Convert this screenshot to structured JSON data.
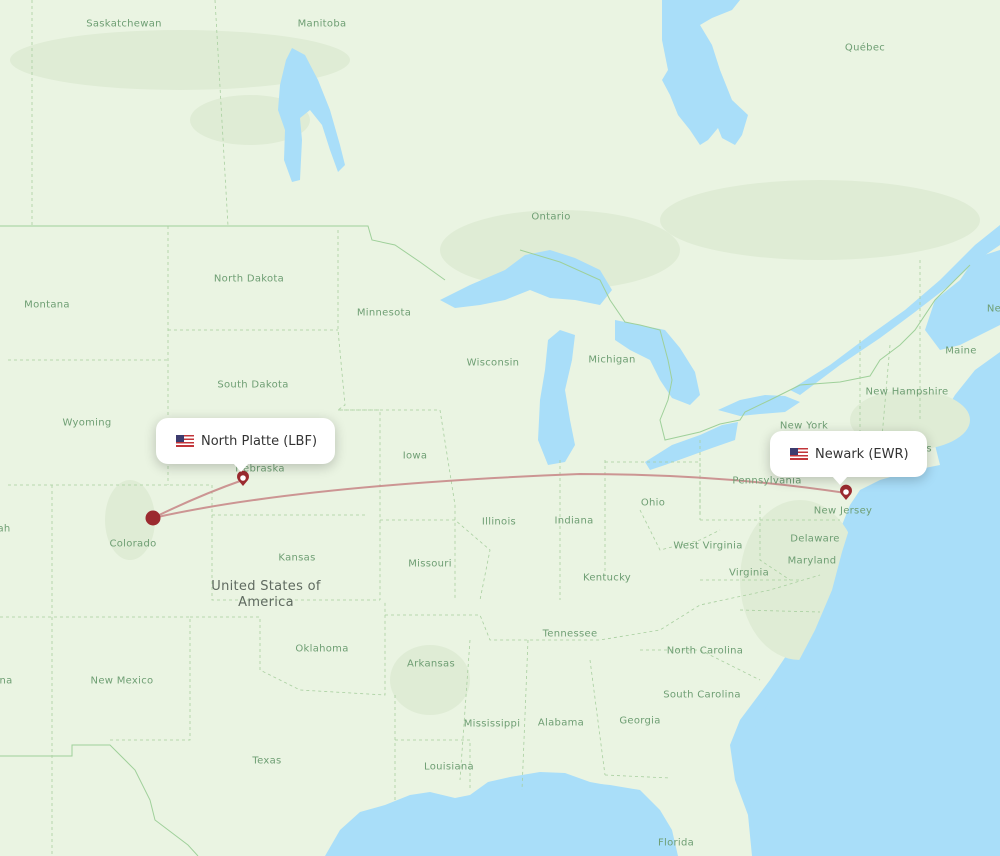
{
  "map": {
    "colors": {
      "water": "#a9def9",
      "land": "#eaf4e2",
      "land_dark": "#dfecd5",
      "border_country": "#9fd09a",
      "border_state": "#a8cf9f",
      "route": "#c98b8b",
      "marker": "#9b2a2f"
    },
    "popups": [
      {
        "id": "lbf",
        "flag": "us-flag-icon",
        "label": "North Platte (LBF)"
      },
      {
        "id": "ewr",
        "flag": "us-flag-icon",
        "label": "Newark (EWR)"
      }
    ],
    "region_labels": {
      "saskatchewan": "Saskatchewan",
      "manitoba": "Manitoba",
      "quebec": "Québec",
      "ontario": "Ontario",
      "montana": "Montana",
      "north_dakota": "North Dakota",
      "minnesota": "Minnesota",
      "south_dakota": "South Dakota",
      "wyoming": "Wyoming",
      "nebraska": "Nebraska",
      "iowa": "Iowa",
      "wisconsin": "Wisconsin",
      "michigan": "Michigan",
      "colorado": "Colorado",
      "kansas": "Kansas",
      "missouri": "Missouri",
      "illinois": "Illinois",
      "indiana": "Indiana",
      "ohio": "Ohio",
      "pennsylvania": "Pennsylvania",
      "new_york": "New York",
      "new_jersey": "New Jersey",
      "maine": "Maine",
      "new_hampshire": "New Hampshire",
      "massachusetts_partial": "ts",
      "new_brunswick_partial": "Ne",
      "utah_partial": "ah",
      "arizona_partial": "na",
      "west_virginia": "West Virginia",
      "virginia": "Virginia",
      "delaware": "Delaware",
      "maryland": "Maryland",
      "kentucky": "Kentucky",
      "tennessee": "Tennessee",
      "north_carolina": "North Carolina",
      "south_carolina": "South Carolina",
      "georgia": "Georgia",
      "alabama": "Alabama",
      "mississippi": "Mississippi",
      "louisiana": "Louisiana",
      "arkansas": "Arkansas",
      "oklahoma": "Oklahoma",
      "new_mexico": "New Mexico",
      "texas": "Texas",
      "florida": "Florida",
      "usa": "United States of America"
    }
  }
}
